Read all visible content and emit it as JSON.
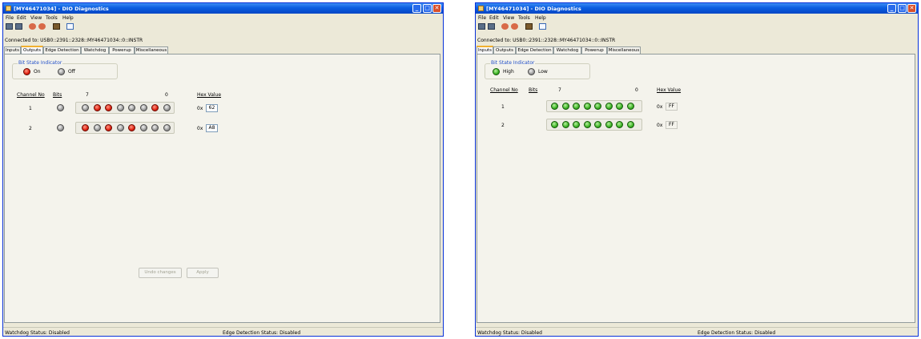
{
  "windows": [
    {
      "title": "[MY46471034] - DIO Diagnostics",
      "menu": [
        "File",
        "Edit",
        "View",
        "Tools",
        "Help"
      ],
      "toolbar_icons": [
        "connect-icon",
        "disconnect-icon",
        "refresh-icon",
        "reset-icon",
        "help-icon"
      ],
      "connected": "Connected to: USB0::2391::2328::MY46471034::0::INSTR",
      "tabs": [
        "Inputs",
        "Outputs",
        "Edge Detection",
        "Watchdog",
        "Powerup",
        "Miscellaneous"
      ],
      "active_tab": "Outputs",
      "group_title": "Bit State Indicator",
      "legend": [
        {
          "label": "On",
          "state": "red"
        },
        {
          "label": "Off",
          "state": "grey"
        }
      ],
      "headers": {
        "channel": "Channel No",
        "bits": "Bits",
        "hi": "7",
        "lo": "0",
        "hex": "Hex Value"
      },
      "hex_prefix": "0x",
      "channels": [
        {
          "name": "1",
          "enable": "grey",
          "bits": [
            "grey",
            "red",
            "red",
            "grey",
            "grey",
            "grey",
            "red",
            "grey"
          ],
          "hex": "62"
        },
        {
          "name": "2",
          "enable": "grey",
          "bits": [
            "red",
            "grey",
            "red",
            "grey",
            "red",
            "grey",
            "grey",
            "grey"
          ],
          "hex": "A8"
        }
      ],
      "buttons": {
        "undo": "Undo changes",
        "apply": "Apply"
      },
      "status": {
        "watchdog": "Watchdog Status: Disabled",
        "edge": "Edge Detection Status: Disabled"
      }
    },
    {
      "title": "[MY46471034] - DIO Diagnostics",
      "menu": [
        "File",
        "Edit",
        "View",
        "Tools",
        "Help"
      ],
      "toolbar_icons": [
        "connect-icon",
        "disconnect-icon",
        "refresh-icon",
        "reset-icon",
        "help-icon"
      ],
      "connected": "Connected to: USB0::2391::2328::MY46471034::0::INSTR",
      "tabs": [
        "Inputs",
        "Outputs",
        "Edge Detection",
        "Watchdog",
        "Powerup",
        "Miscellaneous"
      ],
      "active_tab": "Inputs",
      "group_title": "Bit State Indicator",
      "legend": [
        {
          "label": "High",
          "state": "green"
        },
        {
          "label": "Low",
          "state": "grey"
        }
      ],
      "headers": {
        "channel": "Channel No",
        "bits": "Bits",
        "hi": "7",
        "lo": "0",
        "hex": "Hex Value"
      },
      "hex_prefix": "0x",
      "channels": [
        {
          "name": "1",
          "bits": [
            "green",
            "green",
            "green",
            "green",
            "green",
            "green",
            "green",
            "green"
          ],
          "hex": "FF"
        },
        {
          "name": "2",
          "bits": [
            "green",
            "green",
            "green",
            "green",
            "green",
            "green",
            "green",
            "green"
          ],
          "hex": "FF"
        }
      ],
      "status": {
        "watchdog": "Watchdog Status: Disabled",
        "edge": "Edge Detection Status: Disabled"
      }
    }
  ],
  "colors": {
    "titlebar": "#0a5de0",
    "led_on": "#e02010",
    "led_off": "#9a9a9a",
    "led_high": "#3cb424",
    "active_tab": "#f0b030"
  }
}
